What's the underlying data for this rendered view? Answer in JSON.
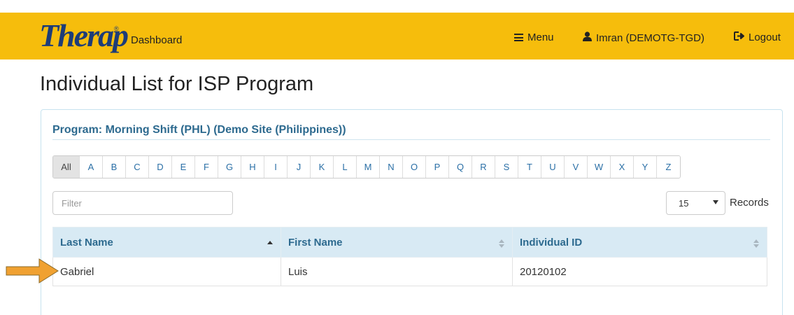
{
  "header": {
    "logo_text": "Therap",
    "logo_mark": "®",
    "dashboard_label": "Dashboard",
    "menu_label": "Menu",
    "user_label": "Imran (DEMOTG-TGD)",
    "logout_label": "Logout",
    "bar_color": "#f6bd0c"
  },
  "page": {
    "title": "Individual List for ISP Program"
  },
  "panel": {
    "program_heading": "Program: Morning Shift (PHL) (Demo Site (Philippines))"
  },
  "alphabet": {
    "selected": "All",
    "letters": [
      "All",
      "A",
      "B",
      "C",
      "D",
      "E",
      "F",
      "G",
      "H",
      "I",
      "J",
      "K",
      "L",
      "M",
      "N",
      "O",
      "P",
      "Q",
      "R",
      "S",
      "T",
      "U",
      "V",
      "W",
      "X",
      "Y",
      "Z"
    ]
  },
  "filter": {
    "placeholder": "Filter",
    "value": ""
  },
  "records": {
    "selected": "15",
    "label": "Records"
  },
  "table": {
    "columns": [
      "Last Name",
      "First Name",
      "Individual ID"
    ],
    "sort": {
      "column": "Last Name",
      "direction": "asc"
    },
    "rows": [
      [
        "Gabriel",
        "Luis",
        "20120102"
      ]
    ]
  },
  "annotation": {
    "arrow_color": "#f0a131",
    "points_to": "Gabriel"
  }
}
